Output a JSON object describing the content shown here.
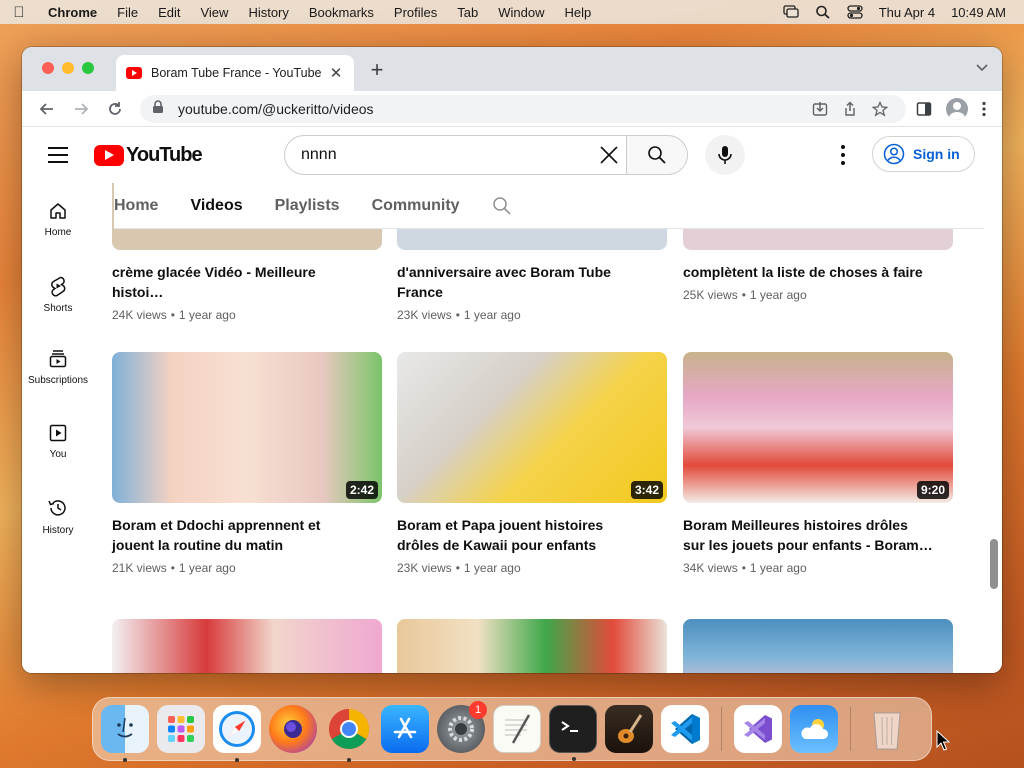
{
  "menubar": {
    "app_name": "Chrome",
    "menus": [
      "File",
      "Edit",
      "View",
      "History",
      "Bookmarks",
      "Profiles",
      "Tab",
      "Window",
      "Help"
    ],
    "date": "Thu Apr 4",
    "time": "10:49 AM"
  },
  "browser": {
    "tab_title": "Boram Tube France - YouTube",
    "url": "youtube.com/@uckeritto/videos"
  },
  "youtube": {
    "logo_text": "YouTube",
    "search_value": "nnnn",
    "sign_in": "Sign in",
    "nav": [
      {
        "label": "Home",
        "icon": "home-icon"
      },
      {
        "label": "Shorts",
        "icon": "shorts-icon"
      },
      {
        "label": "Subscriptions",
        "icon": "subscriptions-icon"
      },
      {
        "label": "You",
        "icon": "you-icon"
      },
      {
        "label": "History",
        "icon": "history-icon"
      }
    ],
    "channel_tabs": [
      "Home",
      "Videos",
      "Playlists",
      "Community"
    ],
    "active_tab": "Videos"
  },
  "videos": [
    {
      "title": "crème glacée Vidéo - Meilleure histoi…",
      "views": "24K views",
      "age": "1 year ago",
      "duration": ""
    },
    {
      "title": "d'anniversaire avec Boram Tube France",
      "views": "23K views",
      "age": "1 year ago",
      "duration": ""
    },
    {
      "title": "complètent la liste de choses à faire",
      "views": "25K views",
      "age": "1 year ago",
      "duration": ""
    },
    {
      "title": "Boram et Ddochi apprennent et jouent la routine du matin",
      "views": "21K views",
      "age": "1 year ago",
      "duration": "2:42"
    },
    {
      "title": "Boram et Papa jouent histoires drôles de Kawaii pour enfants",
      "views": "23K views",
      "age": "1 year ago",
      "duration": "3:42"
    },
    {
      "title": "Boram Meilleures histoires drôles sur les jouets pour enfants - Boram…",
      "views": "34K views",
      "age": "1 year ago",
      "duration": "9:20"
    },
    {
      "title": "",
      "views": "",
      "age": "",
      "duration": ""
    },
    {
      "title": "",
      "views": "",
      "age": "",
      "duration": ""
    },
    {
      "title": "",
      "views": "",
      "age": "",
      "duration": ""
    }
  ],
  "dock": {
    "badge_count": "1",
    "apps": [
      "Finder",
      "Launchpad",
      "Safari",
      "Firefox",
      "Chrome",
      "App Store",
      "System Settings",
      "TextEdit",
      "Terminal",
      "GarageBand",
      "Visual Studio Code",
      "Visual Studio",
      "Weather",
      "Trash"
    ]
  }
}
